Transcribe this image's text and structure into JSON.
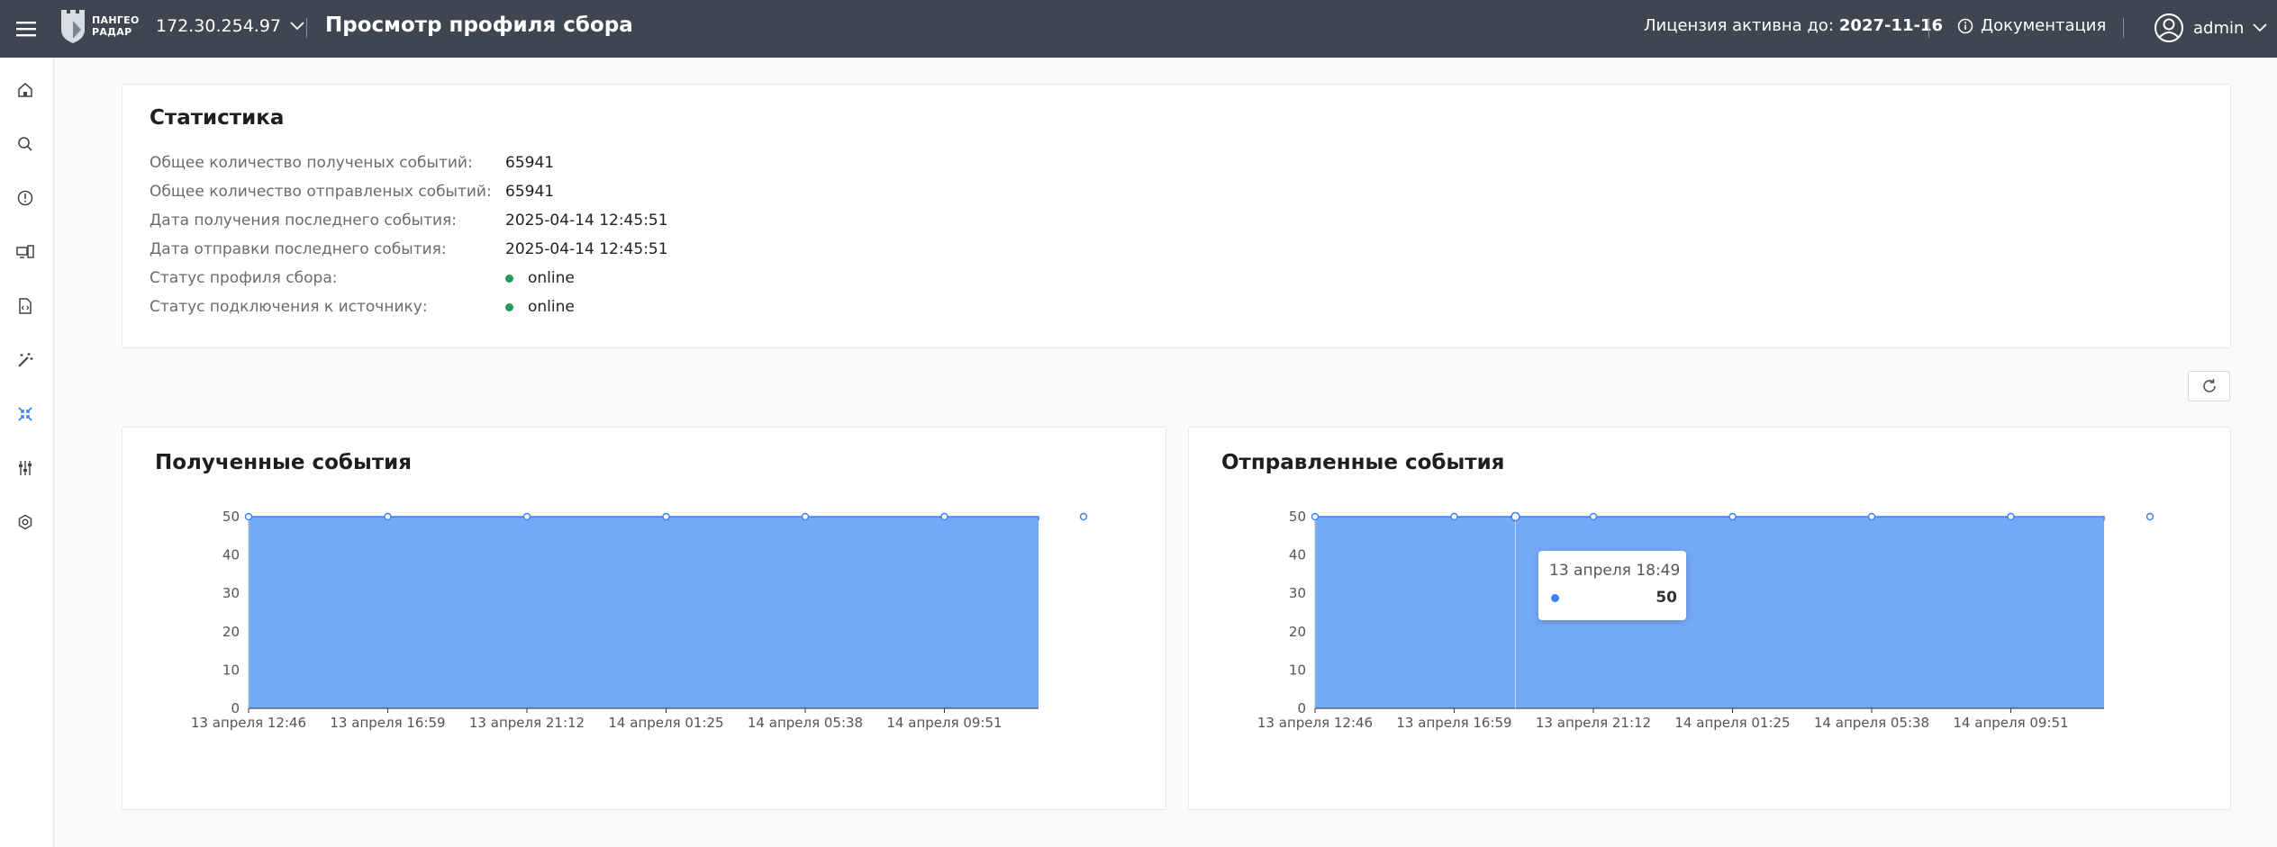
{
  "header": {
    "logo_line1": "ПАНГЕО",
    "logo_line2": "РАДАР",
    "ip": "172.30.254.97",
    "title": "Просмотр профиля сбора",
    "license_label": "Лицензия активна до:",
    "license_date": "2027-11-16",
    "docs_label": "Документация",
    "user": "admin"
  },
  "sidebar": {
    "items": [
      "home-icon",
      "search-icon",
      "info-icon",
      "devices-icon",
      "document-code-icon",
      "magic-wand-icon",
      "collector-icon",
      "sliders-icon",
      "settings-icon"
    ],
    "active_index": 6
  },
  "stats": {
    "title": "Статистика",
    "rows": [
      {
        "label": "Общее количество полученых событий:",
        "value": "65941"
      },
      {
        "label": "Общее количество отправленых событий:",
        "value": "65941"
      },
      {
        "label": "Дата получения последнего события:",
        "value": "2025-04-14 12:45:51"
      },
      {
        "label": "Дата отправки последнего события:",
        "value": "2025-04-14 12:45:51"
      },
      {
        "label": "Статус профиля сбора:",
        "value": "online",
        "status": true
      },
      {
        "label": "Статус подключения к источнику:",
        "value": "online",
        "status": true
      }
    ]
  },
  "colors": {
    "topbar": "#3f4652",
    "online": "#1a9e5c",
    "area_fill": "#6ea6f7",
    "area_line": "#3b82f6",
    "accent": "#3b82f6"
  },
  "chart_data": [
    {
      "type": "area",
      "title": "Полученные события",
      "x": [
        "13 апреля 12:46",
        "13 апреля 16:59",
        "13 апреля 21:12",
        "14 апреля 01:25",
        "14 апреля 05:38",
        "14 апреля 09:51"
      ],
      "y_ticks": [
        0,
        10,
        20,
        30,
        40,
        50
      ],
      "ylim": [
        0,
        50
      ],
      "values": [
        50,
        50,
        50,
        50,
        50,
        50,
        50,
        49,
        50
      ],
      "value_positions": [
        0,
        1,
        2,
        3,
        4,
        5,
        6,
        6.9,
        7
      ],
      "grid": true
    },
    {
      "type": "area",
      "title": "Отправленные события",
      "x": [
        "13 апреля 12:46",
        "13 апреля 16:59",
        "13 апреля 21:12",
        "14 апреля 01:25",
        "14 апреля 05:38",
        "14 апреля 09:51"
      ],
      "y_ticks": [
        0,
        10,
        20,
        30,
        40,
        50
      ],
      "ylim": [
        0,
        50
      ],
      "values": [
        50,
        50,
        50,
        50,
        50,
        50,
        50,
        49,
        50
      ],
      "value_positions": [
        0,
        1,
        2,
        3,
        4,
        5,
        6,
        6.9,
        7
      ],
      "grid": true,
      "tooltip": {
        "label": "13 апреля 18:49",
        "value": "50",
        "position": 1.44
      }
    }
  ]
}
